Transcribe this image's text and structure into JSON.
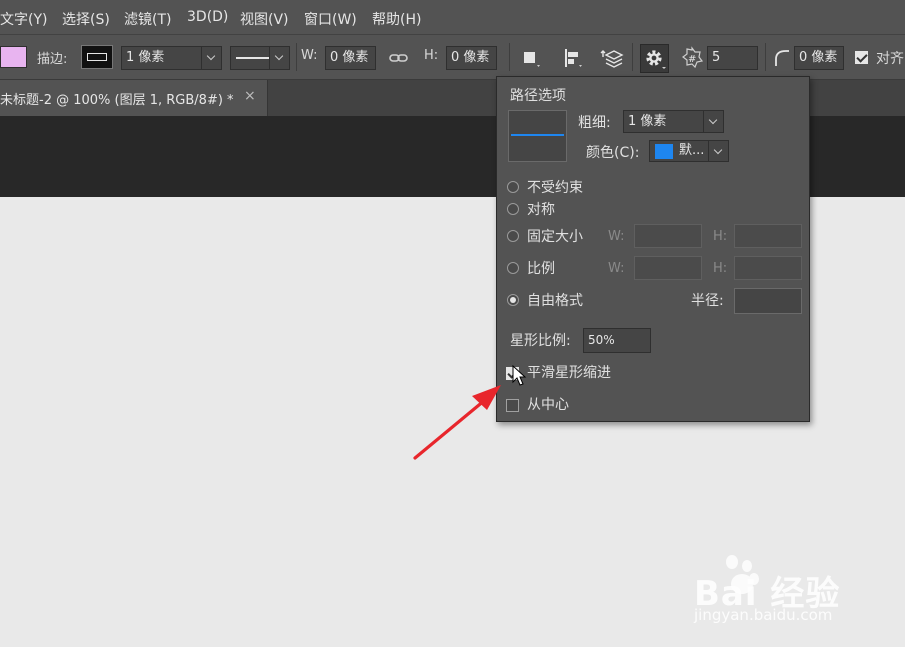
{
  "menu": {
    "items": [
      "文字(Y)",
      "选择(S)",
      "滤镜(T)",
      "3D(D)",
      "视图(V)",
      "窗口(W)",
      "帮助(H)"
    ]
  },
  "options": {
    "stroke_label": "描边:",
    "stroke_width": "1 像素",
    "w_label": "W:",
    "w_value": "0 像素",
    "h_label": "H:",
    "h_value": "0 像素",
    "points_value": "5",
    "radius_value": "0 像素",
    "align_label": "对齐"
  },
  "document": {
    "tab_title": "未标题-2 @ 100% (图层 1, RGB/8#) *",
    "close_glyph": "×"
  },
  "path_options": {
    "title": "路径选项",
    "thickness_label": "粗细:",
    "thickness_value": "1 像素",
    "color_label": "颜色(C):",
    "color_value": "默...",
    "color_swatch": "#1e86f0",
    "radio_options": [
      {
        "label": "不受约束",
        "selected": false
      },
      {
        "label": "对称",
        "selected": false
      },
      {
        "label": "固定大小",
        "selected": false
      },
      {
        "label": "比例",
        "selected": false
      },
      {
        "label": "自由格式",
        "selected": true
      }
    ],
    "w_label": "W:",
    "h_label": "H:",
    "radius_label": "半径:",
    "star_ratio_label": "星形比例:",
    "star_ratio_value": "50%",
    "smooth_indent_label": "平滑星形缩进",
    "smooth_indent_checked": true,
    "from_center_label": "从中心",
    "from_center_checked": false
  },
  "colors": {
    "fill_swatch": "#e8b4f0",
    "arrow": "#e8262c"
  },
  "watermark": {
    "main": "Bai 经验",
    "sub": "jingyan.baidu.com"
  }
}
